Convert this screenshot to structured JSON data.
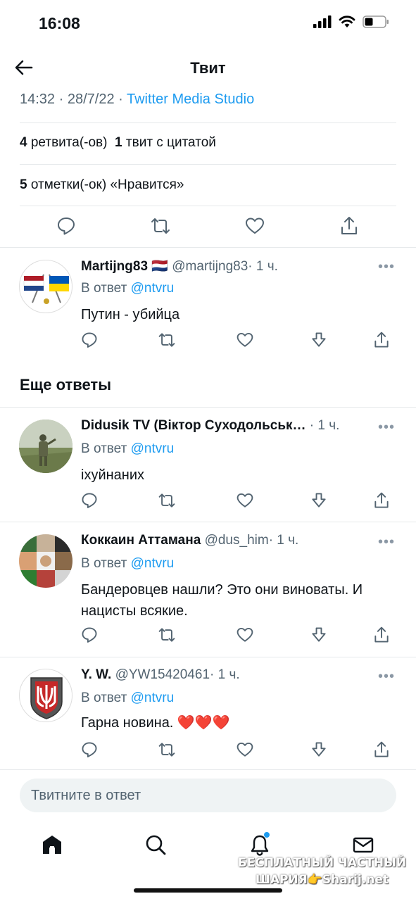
{
  "status": {
    "time": "16:08"
  },
  "header": {
    "title": "Твит"
  },
  "tweet_meta": {
    "time": "14:32",
    "date": "28/7/22",
    "source": "Twitter Media Studio"
  },
  "stats": {
    "retweets_count": "4",
    "retweets_label": "ретвита(-ов)",
    "quotes_count": "1",
    "quotes_label": "твит с цитатой",
    "likes_count": "5",
    "likes_label": "отметки(-ок) «Нравится»"
  },
  "reply_to_label": "В ответ",
  "replies": [
    {
      "name": "Martijng83",
      "flag": "🇳🇱",
      "handle": "@martijng83",
      "time": "· 1 ч.",
      "reply_to": "@ntvru",
      "text": "Путин - убийца"
    },
    {
      "name": "Didusik TV (Віктор Суходольськ…",
      "handle": "",
      "time": "· 1 ч.",
      "reply_to": "@ntvru",
      "text": "іхуйнаних"
    },
    {
      "name": "Коккаин Аттамана",
      "handle": "@dus_him",
      "time": "· 1 ч.",
      "reply_to": "@ntvru",
      "text": "Бандеровцев нашли? Это они виноваты. И нацисты всякие."
    },
    {
      "name": "Y. W.",
      "handle": "@YW15420461",
      "time": "· 1 ч.",
      "reply_to": "@ntvru",
      "text": "Гарна новина. ❤️❤️❤️"
    }
  ],
  "more_replies_title": "Еще ответы",
  "compose": {
    "placeholder": "Твитните в ответ"
  },
  "watermark": {
    "line1": "БЕСПЛАТНЫЙ ЧАСТНЫЙ",
    "line2": "ШАРИЯ👉Sharij.net"
  },
  "colors": {
    "accent": "#1d9bf0",
    "muted": "#536471",
    "notification_dot": "#1d9bf0"
  }
}
